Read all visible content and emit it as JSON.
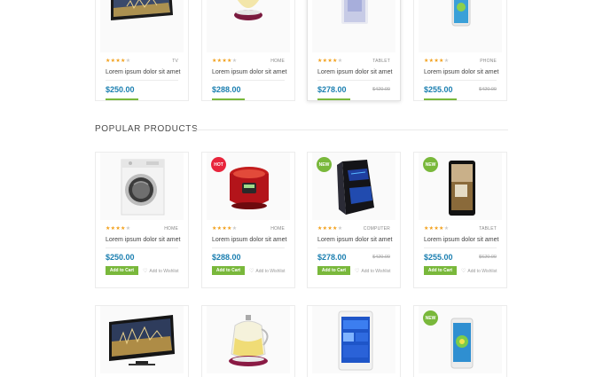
{
  "colors": {
    "accent_green": "#79b83b",
    "price_blue": "#1b7fb0",
    "hot_badge": "#e8253c",
    "new_badge": "#79b83b",
    "star": "#f2a01b"
  },
  "section": {
    "title": "POPULAR PRODUCTS"
  },
  "common": {
    "add_to_cart": "Add to Cart",
    "add_to_wishlist": "Add to Wishlist"
  },
  "top_row": [
    {
      "icon": "tv-icon",
      "rating": 4,
      "category": "TV",
      "title": "Lorem ipsum dolor sit amet",
      "price": "$250.00",
      "old_price": ""
    },
    {
      "icon": "kettle-icon",
      "rating": 4,
      "category": "HOME",
      "title": "Lorem ipsum dolor sit amet",
      "price": "$288.00",
      "old_price": ""
    },
    {
      "icon": "tablet-icon",
      "rating": 4,
      "category": "TABLET",
      "title": "Lorem ipsum dolor sit amet",
      "price": "$278.00",
      "old_price": "$420.00"
    },
    {
      "icon": "phone-icon",
      "rating": 4,
      "category": "PHONE",
      "title": "Lorem ipsum dolor sit amet",
      "price": "$255.00",
      "old_price": "$420.00"
    }
  ],
  "popular": [
    {
      "icon": "washing-machine-icon",
      "badge": "",
      "rating": 4,
      "category": "HOME",
      "title": "Lorem ipsum dolor sit amet",
      "price": "$250.00",
      "old_price": ""
    },
    {
      "icon": "rice-cooker-icon",
      "badge": "HOT",
      "rating": 4,
      "category": "HOME",
      "title": "Lorem ipsum dolor sit amet",
      "price": "$288.00",
      "old_price": ""
    },
    {
      "icon": "computer-case-icon",
      "badge": "NEW",
      "rating": 4,
      "category": "COMPUTER",
      "title": "Lorem ipsum dolor sit amet",
      "price": "$278.00",
      "old_price": "$420.00"
    },
    {
      "icon": "tablet-icon",
      "badge": "NEW",
      "rating": 4,
      "category": "TABLET",
      "title": "Lorem ipsum dolor sit amet",
      "price": "$255.00",
      "old_price": "$620.00"
    }
  ],
  "bottom_row": [
    {
      "icon": "tv-icon",
      "badge": ""
    },
    {
      "icon": "kettle-icon",
      "badge": ""
    },
    {
      "icon": "tablet-icon",
      "badge": ""
    },
    {
      "icon": "phone-icon",
      "badge": "NEW"
    }
  ]
}
